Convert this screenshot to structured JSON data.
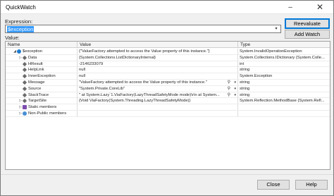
{
  "window": {
    "title": "QuickWatch"
  },
  "controls": {
    "minimize": "–",
    "close": "✕"
  },
  "expression": {
    "label": "Expression:",
    "value": "$exception",
    "dropdown_glyph": "▾"
  },
  "value_label": "Value:",
  "buttons": {
    "reevaluate": "Reevaluate",
    "add_watch": "Add Watch",
    "close": "Close",
    "help": "Help"
  },
  "grid": {
    "columns": [
      "Name",
      "Value",
      "Type"
    ],
    "rows": [
      {
        "name": "$exception",
        "value": "{\"ValueFactory attempted to access the Value property of this instance.\"}",
        "type": "System.InvalidOperationException",
        "expand": "◢",
        "icon": "exception-icon"
      },
      {
        "name": "Data",
        "value": "{System.Collections.ListDictionaryInternal}",
        "type": "System.Collections.IDictionary {System.Colle...",
        "expand": "▷",
        "icon": "property-icon"
      },
      {
        "name": "HResult",
        "value": "-2146233079",
        "type": "int",
        "expand": "",
        "icon": "property-icon"
      },
      {
        "name": "HelpLink",
        "value": "null",
        "type": "string",
        "expand": "",
        "icon": "property-icon"
      },
      {
        "name": "InnerException",
        "value": "null",
        "type": "System.Exception",
        "expand": "",
        "icon": "property-icon"
      },
      {
        "name": "Message",
        "value": "\"ValueFactory attempted to access the Value property of this instance.\"",
        "type": "string",
        "expand": "",
        "icon": "property-icon",
        "viewer": true
      },
      {
        "name": "Source",
        "value": "\"System.Private.CoreLib\"",
        "type": "string",
        "expand": "",
        "icon": "property-icon",
        "viewer": true
      },
      {
        "name": "StackTrace",
        "value": "\"   at System.Lazy`1.ViaFactory(LazyThreadSafetyMode mode)\\r\\n   at System...",
        "type": "string",
        "expand": "",
        "icon": "property-icon",
        "viewer": true
      },
      {
        "name": "TargetSite",
        "value": "{Void ViaFactory(System.Threading.LazyThreadSafetyMode)}",
        "type": "System.Reflection.MethodBase {System.Refl...",
        "expand": "▷",
        "icon": "property-icon"
      },
      {
        "name": "Static members",
        "value": "",
        "type": "",
        "expand": "▷",
        "icon": "static-members-icon"
      },
      {
        "name": "Non-Public members",
        "value": "",
        "type": "",
        "expand": "▷",
        "icon": "non-public-members-icon"
      }
    ]
  }
}
